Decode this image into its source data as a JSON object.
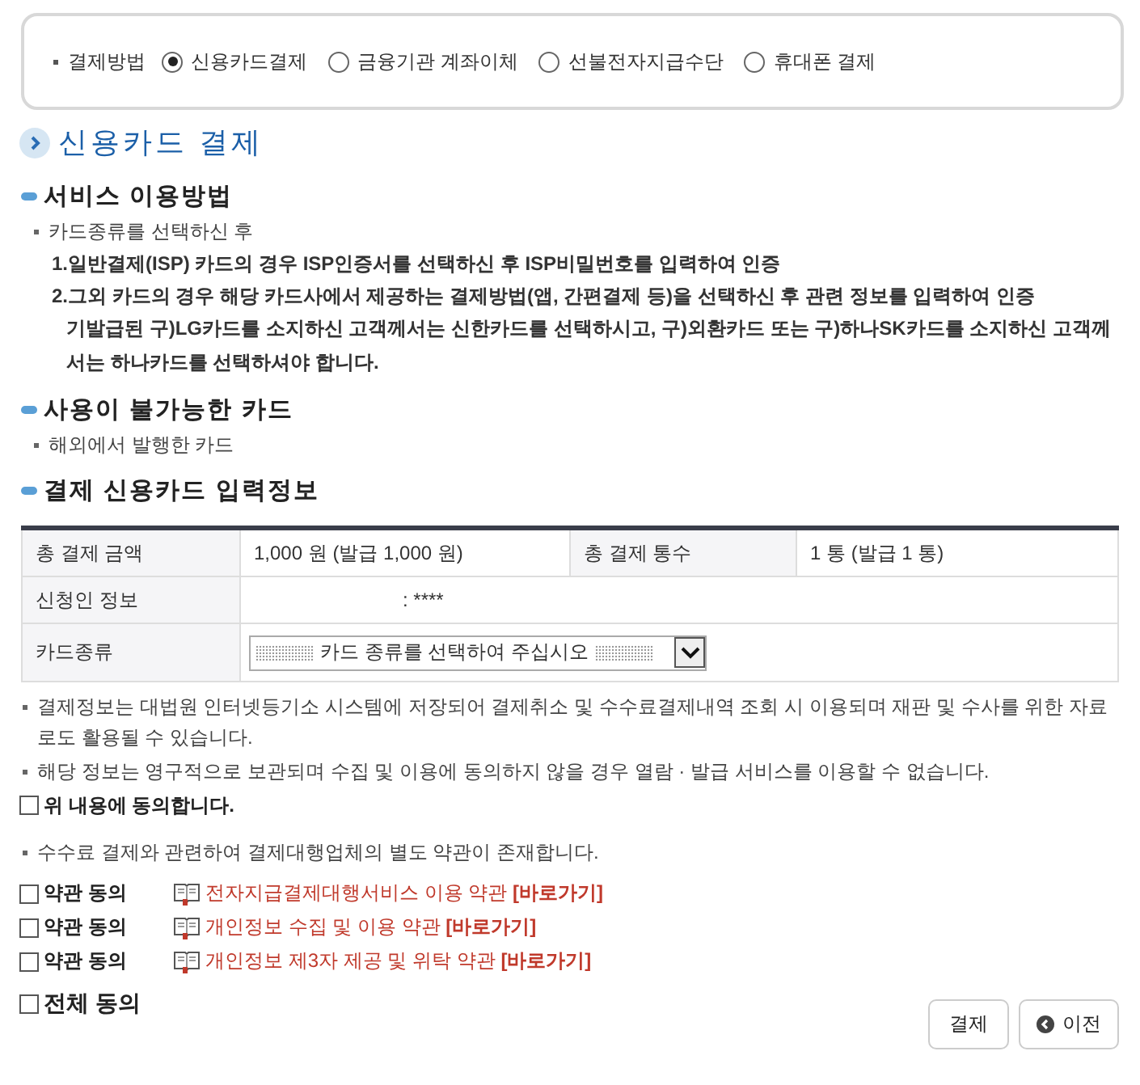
{
  "payment_method": {
    "label": "결제방법",
    "options": [
      {
        "label": "신용카드결제",
        "selected": true
      },
      {
        "label": "금융기관 계좌이체",
        "selected": false
      },
      {
        "label": "선불전자지급수단",
        "selected": false
      },
      {
        "label": "휴대폰 결제",
        "selected": false
      }
    ]
  },
  "page_title": "신용카드 결제",
  "sections": [
    {
      "heading": "서비스 이용방법",
      "bullets": [
        "카드종류를 선택하신 후"
      ],
      "steps": [
        "1.일반결제(ISP) 카드의 경우 ISP인증서를 선택하신 후 ISP비밀번호를 입력하여 인증",
        "2.그외 카드의 경우 해당 카드사에서 제공하는 결제방법(앱, 간편결제 등)을 선택하신 후 관련 정보를 입력하여 인증"
      ],
      "note": "기발급된 구)LG카드를 소지하신 고객께서는 신한카드를 선택하시고, 구)외환카드 또는 구)하나SK카드를 소지하신 고객께서는 하나카드를 선택하셔야 합니다."
    },
    {
      "heading": "사용이 불가능한 카드",
      "bullets": [
        "해외에서 발행한 카드"
      ]
    },
    {
      "heading": "결제 신용카드 입력정보"
    }
  ],
  "table": {
    "rows": [
      {
        "cells": [
          {
            "kind": "label",
            "text": "총 결제 금액"
          },
          {
            "kind": "value",
            "text": "1,000 원 (발급 1,000 원)"
          },
          {
            "kind": "label",
            "text": "총 결제 통수"
          },
          {
            "kind": "value",
            "text": "1 통 (발급 1 통)"
          }
        ]
      },
      {
        "cells": [
          {
            "kind": "label",
            "text": "신청인 정보"
          },
          {
            "kind": "wide",
            "colspan": 3,
            "text": ": ****"
          }
        ]
      },
      {
        "cells": [
          {
            "kind": "label",
            "text": "카드종류"
          },
          {
            "kind": "select",
            "colspan": 3,
            "placeholder": "카드 종류를 선택하여 주십시오"
          }
        ]
      }
    ]
  },
  "notices": [
    "결제정보는 대법원 인터넷등기소 시스템에 저장되어 결제취소 및 수수료결제내역 조회 시 이용되며 재판 및 수사를 위한 자료로도 활용될 수 있습니다.",
    "해당 정보는 영구적으로 보관되며 수집 및 이용에 동의하지 않을 경우 열람 · 발급 서비스를 이용할 수 없습니다."
  ],
  "agree": {
    "label": "위 내용에 동의합니다.",
    "checked": false
  },
  "terms_notice": "수수료 결제와 관련하여 결제대행업체의 별도 약관이 존재합니다.",
  "terms": [
    {
      "label": "약관 동의",
      "link": "전자지급결제대행서비스 이용 약관 **[바로가기]**",
      "checked": false
    },
    {
      "label": "약관 동의",
      "link": "개인정보 수집 및 이용 약관 **[바로가기]**",
      "checked": false
    },
    {
      "label": "약관 동의",
      "link": "개인정보 제3자 제공 및 위탁 약관 **[바로가기]**",
      "checked": false
    }
  ],
  "all_agree": {
    "label": "전체 동의",
    "checked": false
  },
  "buttons": [
    {
      "kind": "pay",
      "label": "결제"
    },
    {
      "kind": "back",
      "label": "이전"
    }
  ]
}
